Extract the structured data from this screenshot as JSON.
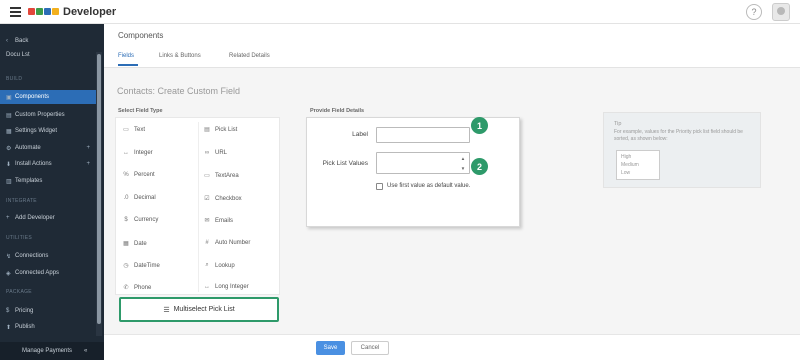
{
  "app": {
    "brand": "Developer"
  },
  "sidebar": {
    "back_label": "Back",
    "crumb": "Docu Lst",
    "section_build": "BUILD",
    "items": [
      {
        "label": "Components",
        "active": true
      },
      {
        "label": "Custom Properties"
      },
      {
        "label": "Settings Widget"
      },
      {
        "label": "Automate",
        "expandable": true
      },
      {
        "label": "Install Actions",
        "expandable": true
      },
      {
        "label": "Templates"
      }
    ],
    "section_integrate": "INTEGRATE",
    "integrate_items": [
      {
        "label": "Add Developer"
      }
    ],
    "section_utilities": "UTILITIES",
    "utility_items": [
      {
        "label": "Connections"
      },
      {
        "label": "Connected Apps"
      }
    ],
    "section_package": "PACKAGE",
    "package_items": [
      {
        "label": "Pricing"
      },
      {
        "label": "Publish"
      }
    ],
    "footer_label": "Manage Payments"
  },
  "header": {
    "title": "Components",
    "tabs": [
      {
        "label": "Fields"
      },
      {
        "label": "Links & Buttons"
      },
      {
        "label": "Related Details"
      }
    ]
  },
  "page": {
    "title": "Contacts: Create Custom Field"
  },
  "field_types": {
    "heading": "Select Field Type",
    "items": [
      {
        "label": "Text",
        "icon": "text-icon"
      },
      {
        "label": "Pick List",
        "icon": "picklist-icon"
      },
      {
        "label": "Integer",
        "icon": "integer-icon"
      },
      {
        "label": "URL",
        "icon": "url-icon"
      },
      {
        "label": "Percent",
        "icon": "percent-icon"
      },
      {
        "label": "TextArea",
        "icon": "textarea-icon"
      },
      {
        "label": "Decimal",
        "icon": "decimal-icon"
      },
      {
        "label": "Checkbox",
        "icon": "checkbox-icon"
      },
      {
        "label": "Currency",
        "icon": "currency-icon"
      },
      {
        "label": "Emails",
        "icon": "email-icon"
      },
      {
        "label": "Date",
        "icon": "date-icon"
      },
      {
        "label": "Auto Number",
        "icon": "autonumber-icon"
      },
      {
        "label": "DateTime",
        "icon": "datetime-icon"
      },
      {
        "label": "Lookup",
        "icon": "lookup-icon"
      },
      {
        "label": "Phone",
        "icon": "phone-icon"
      },
      {
        "label": "Long Integer",
        "icon": "long-integer-icon"
      }
    ],
    "selected": {
      "label": "Multiselect Pick List",
      "icon": "multiselect-icon"
    }
  },
  "details": {
    "heading": "Provide Field Details",
    "label_field": {
      "label": "Label",
      "value": ""
    },
    "picklist_field": {
      "label": "Pick List Values",
      "value": ""
    },
    "default_checkbox": {
      "label": "Use first value as default value.",
      "checked": false
    }
  },
  "badges": [
    "1",
    "2"
  ],
  "tip": {
    "title": "Tip",
    "text": "For example, values for the Priority pick list field should be sorted, as shown below:",
    "options": [
      "High",
      "Medium",
      "Low"
    ]
  },
  "actions": {
    "save": "Save",
    "cancel": "Cancel"
  },
  "colors": {
    "sidebar_bg": "#1f2a36",
    "active": "#2c6db6",
    "highlight": "#2e9a6a",
    "save": "#4a90e2"
  }
}
